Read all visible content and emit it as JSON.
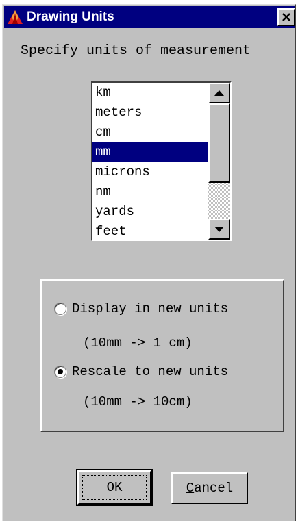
{
  "window": {
    "title": "Drawing Units"
  },
  "prompt": "Specify units of measurement",
  "units_list": {
    "items": [
      "km",
      "meters",
      "cm",
      "mm",
      "microns",
      "nm",
      "yards",
      "feet"
    ],
    "selected": "mm"
  },
  "options": [
    {
      "label": "Display in new units",
      "note": "(10mm -> 1 cm)",
      "checked": false
    },
    {
      "label": "Rescale to new units",
      "note": "(10mm -> 10cm)",
      "checked": true
    }
  ],
  "buttons": {
    "ok": {
      "accel": "O",
      "rest": "K"
    },
    "cancel": {
      "accel": "C",
      "rest": "ancel"
    }
  },
  "colors": {
    "titlebar": "#000080",
    "face": "#c0c0c0",
    "selection": "#000080"
  },
  "icons": {
    "app": "app-logo-icon",
    "close": "close-icon"
  }
}
